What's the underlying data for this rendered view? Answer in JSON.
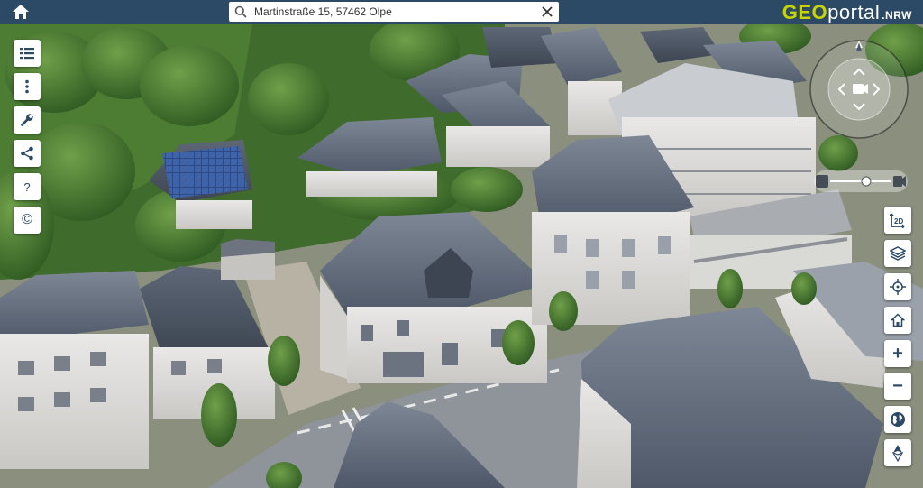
{
  "header": {
    "logo_geo": "GEO",
    "logo_portal": "portal",
    "logo_nrw": ".NRW"
  },
  "search": {
    "value": "Martinstraße 15, 57462 Olpe",
    "placeholder": "Martinstraße 15, 57462 Olpe"
  },
  "left_toolbar": {
    "items": [
      {
        "name": "menu-list",
        "icon": "list-icon"
      },
      {
        "name": "more-options",
        "icon": "vertical-dots-icon"
      },
      {
        "name": "tools",
        "icon": "wrench-icon"
      },
      {
        "name": "share",
        "icon": "share-icon"
      },
      {
        "name": "help",
        "label": "?"
      },
      {
        "name": "copyright",
        "label": "©"
      }
    ]
  },
  "right_toolbar": {
    "mode_label": "2D",
    "zoom_in_label": "+",
    "zoom_out_label": "−",
    "items": [
      "2d-mode-icon",
      "layers-icon",
      "locate-icon",
      "home-icon",
      "zoom-in",
      "zoom-out",
      "globe-icon",
      "north-arrow-icon"
    ]
  },
  "colors": {
    "topbar": "#2c4a66",
    "logo_accent": "#c8d400",
    "button_icon": "#2c4a66",
    "button_bg": "#ffffff"
  }
}
